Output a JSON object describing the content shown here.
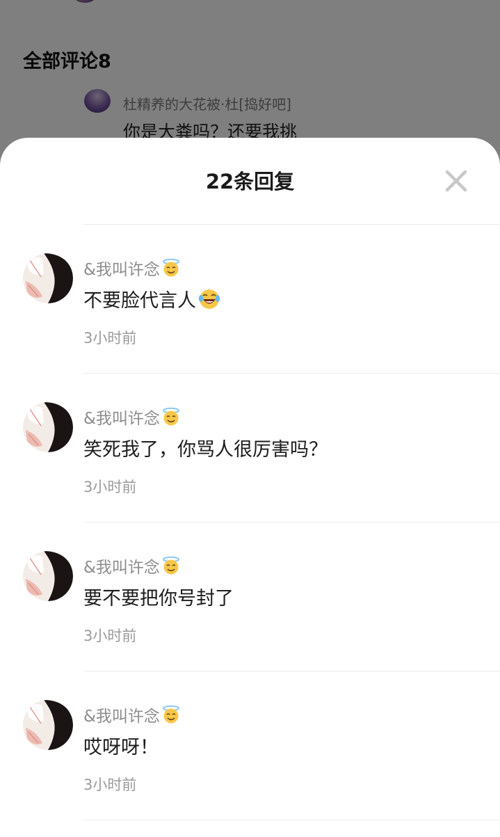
{
  "background": {
    "section_title": "全部评论8",
    "comment": {
      "name": "杜精养的大花被·杜[捣好吧]",
      "text": "你是大粪吗？还要我挑"
    }
  },
  "sheet": {
    "title": "22条回复",
    "close_icon": "close-icon",
    "replies": [
      {
        "name": "&我叫许念",
        "name_icon": "smiling-face-with-halo-emoji",
        "text": "不要脸代言人",
        "text_icon": "tears-of-joy-emoji",
        "time": "3小时前"
      },
      {
        "name": "&我叫许念",
        "name_icon": "smiling-face-with-halo-emoji",
        "text": "笑死我了，你骂人很厉害吗？",
        "time": "3小时前"
      },
      {
        "name": "&我叫许念",
        "name_icon": "smiling-face-with-halo-emoji",
        "text": "要不要把你号封了",
        "time": "3小时前"
      },
      {
        "name": "&我叫许念",
        "name_icon": "smiling-face-with-halo-emoji",
        "text": "哎呀呀！",
        "time": "3小时前"
      }
    ]
  },
  "colors": {
    "overlay": "#000000",
    "name_gray": "#8c8c8c",
    "time_gray": "#9a9a9a",
    "close_gray": "#c8c8c8"
  }
}
